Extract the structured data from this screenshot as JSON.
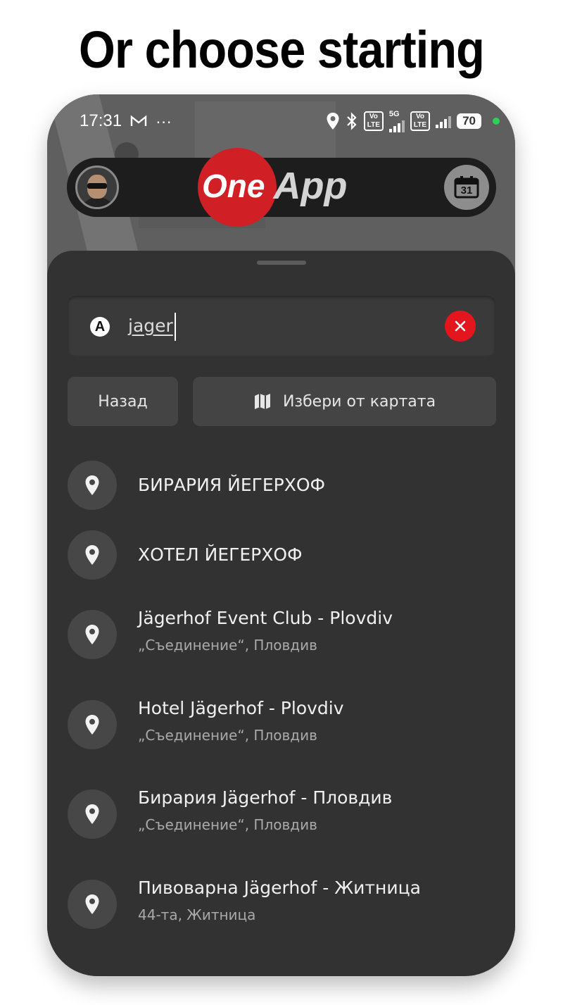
{
  "headline": "Or choose starting",
  "status_bar": {
    "time": "17:31",
    "network": "5G",
    "battery": "70"
  },
  "header": {
    "logo_one": "One",
    "logo_app": "App",
    "calendar_day": "31"
  },
  "search": {
    "query": "jager",
    "origin_badge": "A"
  },
  "buttons": {
    "back": "Назад",
    "pick_from_map": "Избери от картата"
  },
  "results": [
    {
      "title": "БИРАРИЯ ЙЕГЕРХОФ",
      "subtitle": ""
    },
    {
      "title": "ХОТЕЛ ЙЕГЕРХОФ",
      "subtitle": ""
    },
    {
      "title": "Jägerhof Event Club - Plovdiv",
      "subtitle": "„Съединение“, Пловдив"
    },
    {
      "title": "Hotel Jägerhof - Plovdiv",
      "subtitle": "„Съединение“, Пловдив"
    },
    {
      "title": "Бирария Jägerhof - Пловдив",
      "subtitle": "„Съединение“, Пловдив"
    },
    {
      "title": "Пивоварна Jägerhof - Житница",
      "subtitle": "44-та, Житница"
    }
  ],
  "colors": {
    "accent_red": "#e3151d",
    "logo_red": "#d11f26",
    "sheet_bg": "#303030",
    "status_green": "#2ed158"
  }
}
